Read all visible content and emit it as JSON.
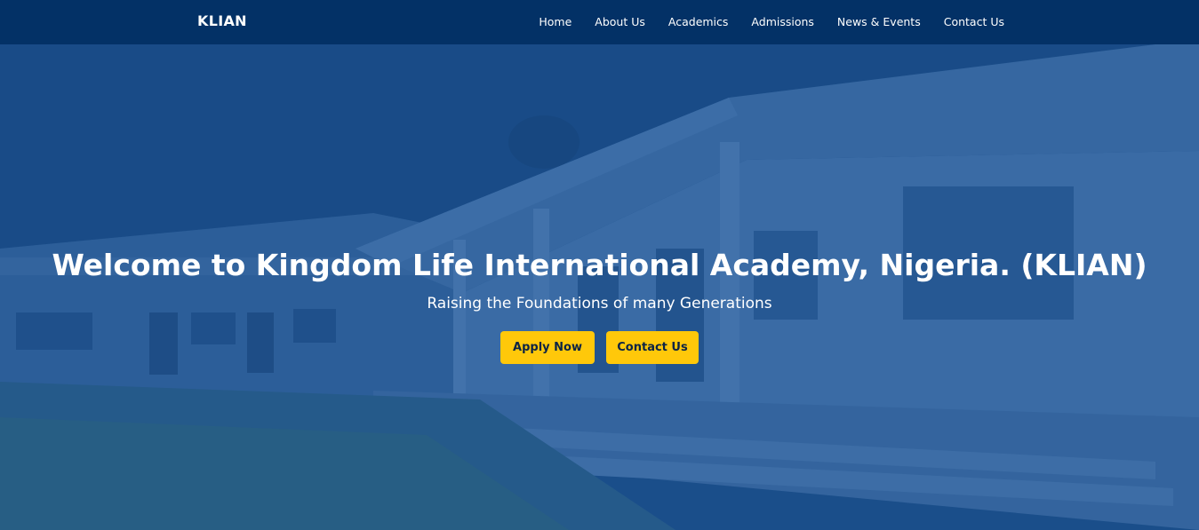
{
  "navbar": {
    "brand": "KLIAN",
    "links": [
      {
        "label": "Home"
      },
      {
        "label": "About Us"
      },
      {
        "label": "Academics"
      },
      {
        "label": "Admissions"
      },
      {
        "label": "News & Events"
      },
      {
        "label": "Contact Us"
      }
    ]
  },
  "hero": {
    "title": "Welcome to Kingdom Life International Academy, Nigeria. (KLIAN)",
    "subtitle": "Raising the Foundations of many Generations",
    "buttons": {
      "apply": "Apply Now",
      "contact": "Contact Us"
    }
  },
  "colors": {
    "navbar_bg": "#033166",
    "overlay": "#144c94",
    "button_bg": "#ffc80a",
    "button_text": "#0b2345"
  }
}
